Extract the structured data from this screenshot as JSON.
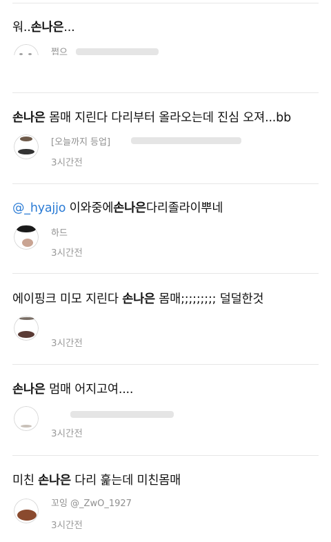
{
  "tweets": [
    {
      "text_parts": [
        "워..",
        "손나은",
        "..."
      ],
      "username_partial": "쩝으",
      "timestamp": ""
    },
    {
      "text_parts": [
        "손나은",
        " 몸매 지린다 다리부터 올라오는데 진심 오져...bb"
      ],
      "username_partial": "[오늘까지 등업]",
      "timestamp": "3시간전"
    },
    {
      "text_parts": [
        "@_hyajjo",
        " 이와중에",
        "손나은",
        "다리졸라이뿌네"
      ],
      "username_partial": "하드",
      "timestamp": "3시간전"
    },
    {
      "text_parts": [
        "에이핑크 미모 지린다 ",
        "손나은",
        " 몸매;;;;;;;;; 덜덜한것"
      ],
      "username_partial": "",
      "timestamp": "3시간전"
    },
    {
      "text_parts": [
        "손나은",
        " 멈매 어지고여...."
      ],
      "username_partial": "",
      "timestamp": "3시간전"
    },
    {
      "text_parts": [
        "미친 ",
        "손나은",
        " 다리 훑는데 미친몸매"
      ],
      "username_partial": "꼬잉 @_ZwO_1927",
      "timestamp": "3시간전"
    }
  ],
  "colors": {
    "mention": "#2a7bd5",
    "divider": "#e6e6e6",
    "meta_text": "#9a9a9a"
  }
}
